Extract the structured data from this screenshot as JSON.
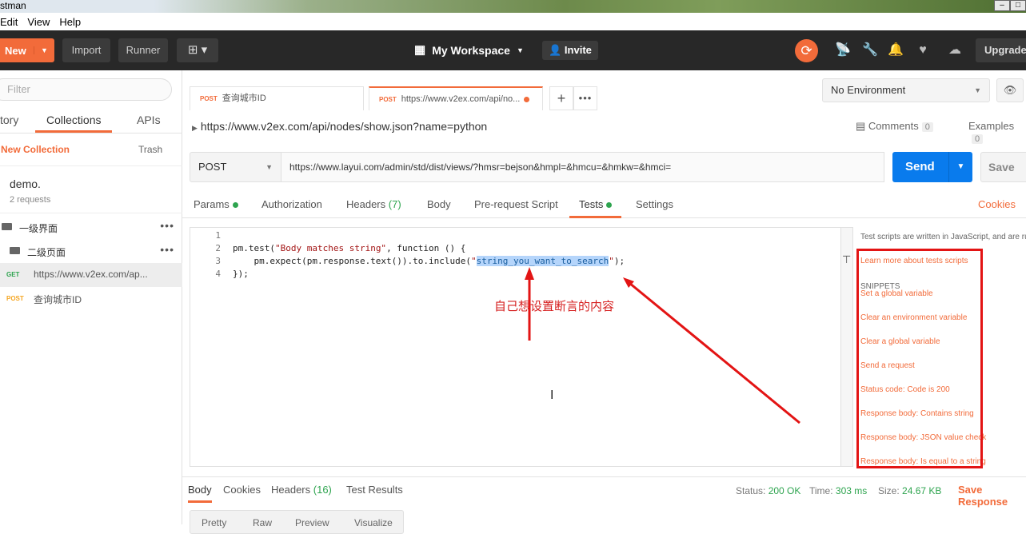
{
  "window": {
    "title": "stman"
  },
  "menu": [
    "Edit",
    "View",
    "Help"
  ],
  "toolbar": {
    "new_label": "New",
    "import_label": "Import",
    "runner_label": "Runner",
    "workspace_label": "My Workspace",
    "invite_label": "Invite",
    "upgrade_label": "Upgrade"
  },
  "sidebar": {
    "filter_placeholder": "Filter",
    "tabs": [
      "tory",
      "Collections",
      "APIs"
    ],
    "new_collection": "New Collection",
    "trash": "Trash",
    "collection": {
      "name": "demo.",
      "count": "2 requests"
    },
    "folders": [
      "一级界面",
      "二级页面"
    ],
    "requests": [
      {
        "method": "GET",
        "url": "https://www.v2ex.com/ap..."
      },
      {
        "method": "POST",
        "url": "查询城市ID"
      }
    ]
  },
  "tabs": [
    {
      "method": "POST",
      "label": "查询城市ID"
    },
    {
      "method": "POST",
      "label": "https://www.v2ex.com/api/no..."
    }
  ],
  "environment": {
    "selected": "No Environment"
  },
  "request": {
    "breadcrumb": "https://www.v2ex.com/api/nodes/show.json?name=python",
    "comments_label": "Comments",
    "comments_count": "0",
    "examples_label": "Examples",
    "examples_count": "0",
    "method": "POST",
    "url": "https://www.layui.com/admin/std/dist/views/?hmsr=bejson&hmpl=&hmcu=&hmkw=&hmci=",
    "send_label": "Send",
    "save_label": "Save",
    "tabs": {
      "params": "Params",
      "authorization": "Authorization",
      "headers": "Headers",
      "headers_count": "(7)",
      "body": "Body",
      "prerequest": "Pre-request Script",
      "tests": "Tests",
      "settings": "Settings",
      "cookies": "Cookies"
    }
  },
  "editor": {
    "line_numbers": [
      "1",
      "2",
      "3",
      "4"
    ],
    "line2_a": "pm.test(",
    "line2_str": "\"Body matches string\"",
    "line2_b": ", function () {",
    "line3_a": "    pm.expect(pm.response.text()).to.include(",
    "line3_q1": "\"",
    "line3_hl": "string_you_want_to_search",
    "line3_q2": "\"",
    "line3_b": ");",
    "line4": "});",
    "annotation": "自己想设置断言的内容"
  },
  "snippets": {
    "description": "Test scripts are written in JavaScript, and are run after the response is received.",
    "learn_more": "Learn more about tests scripts",
    "heading": "SNIPPETS",
    "items": [
      "Set a global variable",
      "Clear an environment variable",
      "Clear a global variable",
      "Send a request",
      "Status code: Code is 200",
      "Response body: Contains string",
      "Response body: JSON value check",
      "Response body: Is equal to a string"
    ]
  },
  "response": {
    "tabs": {
      "body": "Body",
      "cookies": "Cookies",
      "headers": "Headers",
      "headers_count": "(16)",
      "test_results": "Test Results"
    },
    "status_label": "Status:",
    "status_value": "200 OK",
    "time_label": "Time:",
    "time_value": "303 ms",
    "size_label": "Size:",
    "size_value": "24.67 KB",
    "save_response": "Save Response",
    "format_tabs": [
      "Pretty",
      "Raw",
      "Preview",
      "Visualize"
    ]
  },
  "colors": {
    "accent": "#f26b3a",
    "send": "#097bed",
    "annotation": "#e31414",
    "success": "#2ea44f"
  }
}
